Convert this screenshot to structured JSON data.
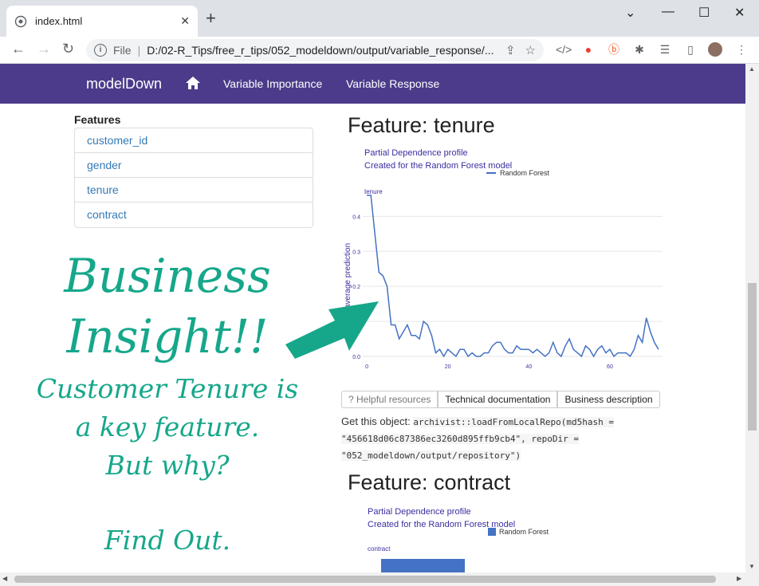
{
  "tab": {
    "title": "index.html"
  },
  "address": {
    "protocol": "File",
    "url": "D:/02-R_Tips/free_r_tips/052_modeldown/output/variable_response/..."
  },
  "site": {
    "brand": "modelDown",
    "nav": [
      "Variable Importance",
      "Variable Response"
    ]
  },
  "features": {
    "heading": "Features",
    "items": [
      "customer_id",
      "gender",
      "tenure",
      "contract"
    ]
  },
  "section1": {
    "title": "Feature: tenure",
    "subtitle1": "Partial Dependence profile",
    "subtitle2": "Created for the Random Forest model",
    "legend": "Random Forest",
    "var_label": "tenure",
    "ylabel": "average prediction"
  },
  "buttons": {
    "helpful": "? Helpful resources",
    "tech": "Technical documentation",
    "business": "Business description"
  },
  "getobj": {
    "label": "Get this object:",
    "code": "archivist::loadFromLocalRepo(md5hash = \"456618d06c87386ec3260d895ffb9cb4\", repoDir = \"052_modeldown/output/repository\")"
  },
  "section2": {
    "title": "Feature: contract",
    "subtitle1": "Partial Dependence profile",
    "subtitle2": "Created for the Random Forest model",
    "legend": "Random Forest",
    "var_label": "contract"
  },
  "annotation": {
    "line1": "Business",
    "line2": "Insight!!",
    "line3": "Customer Tenure is",
    "line4": "a key feature.",
    "line5": "But why?",
    "line6": "Find Out."
  },
  "colors": {
    "nav": "#4c3b8a",
    "accent": "#16a78a",
    "series": "#4472c4"
  },
  "chart_data": {
    "type": "line",
    "title": "Partial Dependence profile",
    "subtitle": "Created for the Random Forest model",
    "xlabel": "",
    "ylabel": "average prediction",
    "xlim": [
      -1,
      73
    ],
    "ylim": [
      0,
      0.46
    ],
    "xticks": [
      0,
      20,
      40,
      60
    ],
    "yticks": [
      0.0,
      0.1,
      0.2,
      0.3,
      0.4
    ],
    "grid": true,
    "legend": "top-right",
    "series": [
      {
        "name": "Random Forest",
        "x": [
          0,
          1,
          2,
          3,
          4,
          5,
          6,
          7,
          8,
          9,
          10,
          11,
          12,
          13,
          14,
          15,
          16,
          17,
          18,
          19,
          20,
          21,
          22,
          23,
          24,
          25,
          26,
          27,
          28,
          29,
          30,
          31,
          32,
          33,
          34,
          35,
          36,
          37,
          38,
          39,
          40,
          41,
          42,
          43,
          44,
          45,
          46,
          47,
          48,
          49,
          50,
          51,
          52,
          53,
          54,
          55,
          56,
          57,
          58,
          59,
          60,
          61,
          62,
          63,
          64,
          65,
          66,
          67,
          68,
          69,
          70,
          71,
          72
        ],
        "y": [
          0.46,
          0.46,
          0.35,
          0.24,
          0.23,
          0.2,
          0.09,
          0.09,
          0.05,
          0.07,
          0.09,
          0.06,
          0.06,
          0.05,
          0.1,
          0.09,
          0.06,
          0.01,
          0.02,
          0.0,
          0.02,
          0.01,
          0.0,
          0.02,
          0.02,
          0.0,
          0.01,
          0.0,
          0.0,
          0.01,
          0.01,
          0.03,
          0.04,
          0.04,
          0.02,
          0.01,
          0.01,
          0.03,
          0.02,
          0.02,
          0.02,
          0.01,
          0.02,
          0.01,
          0.0,
          0.01,
          0.04,
          0.01,
          0.0,
          0.03,
          0.05,
          0.02,
          0.01,
          0.0,
          0.03,
          0.02,
          0.0,
          0.02,
          0.03,
          0.01,
          0.02,
          0.0,
          0.01,
          0.01,
          0.01,
          0.0,
          0.02,
          0.06,
          0.04,
          0.11,
          0.07,
          0.04,
          0.02
        ]
      }
    ]
  }
}
